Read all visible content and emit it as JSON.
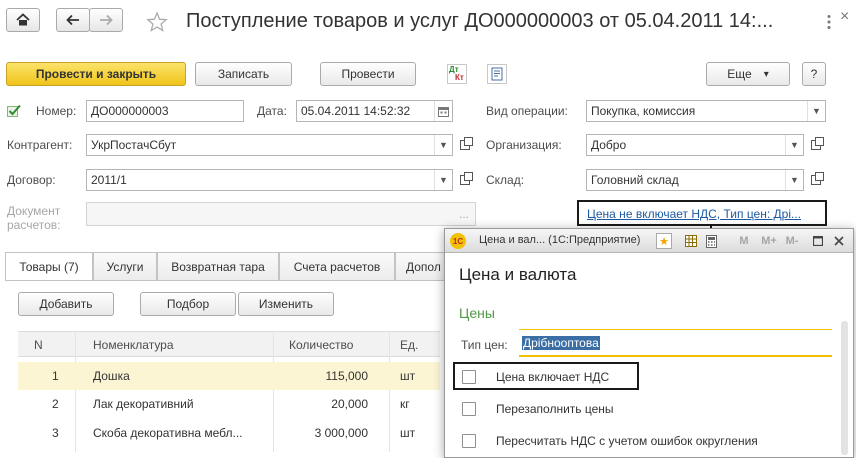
{
  "header": {
    "title": "Поступление товаров и услуг ДО000000003 от 05.04.2011 14:...",
    "more_icon": "more-vertical",
    "close_icon": "×"
  },
  "toolbar": {
    "post_close": "Провести и закрыть",
    "save": "Записать",
    "post": "Провести",
    "dt_kt_top": "Дт",
    "dt_kt_bottom": "Кт",
    "more": "Еще",
    "more_arrow": "▾",
    "help": "?"
  },
  "form": {
    "number_label": "Номер:",
    "number_value": "ДО000000003",
    "date_label": "Дата:",
    "date_value": "05.04.2011 14:52:32",
    "operation_label": "Вид операции:",
    "operation_value": "Покупка, комиссия",
    "counterparty_label": "Контрагент:",
    "counterparty_value": "УкрПостачСбут",
    "organization_label": "Организация:",
    "organization_value": "Добро",
    "contract_label": "Договор:",
    "contract_value": "2011/1",
    "warehouse_label": "Склад:",
    "warehouse_value": "Головний склад",
    "settlement_doc_label_1": "Документ",
    "settlement_doc_label_2": "расчетов:",
    "ellipsis": "...",
    "price_link": "Цена не включает НДС, Тип цен: Дрі..."
  },
  "tabs": [
    {
      "label": "Товары (7)"
    },
    {
      "label": "Услуги"
    },
    {
      "label": "Возвратная тара"
    },
    {
      "label": "Счета расчетов"
    },
    {
      "label": "Допол"
    }
  ],
  "table_toolbar": {
    "add": "Добавить",
    "select": "Подбор",
    "edit": "Изменить"
  },
  "table": {
    "columns": [
      "N",
      "Номенклатура",
      "Количество",
      "Ед."
    ],
    "rows": [
      {
        "n": "1",
        "name": "Дошка",
        "qty": "115,000",
        "unit": "шт"
      },
      {
        "n": "2",
        "name": "Лак декоративний",
        "qty": "20,000",
        "unit": "кг"
      },
      {
        "n": "3",
        "name": "Скоба декоративна мебл...",
        "qty": "3 000,000",
        "unit": "шт"
      }
    ]
  },
  "modal": {
    "window_title": "Цена и вал... (1С:Предприятие)",
    "logo_text": "1С",
    "m_label": "M",
    "m_plus_label": "M+",
    "m_minus_label": "M-",
    "heading": "Цена и валюта",
    "section": "Цены",
    "price_type_label": "Тип цен:",
    "price_type_value": "Дрібнооптова",
    "cb_includes_vat": "Цена включает НДС",
    "cb_refill_prices": "Перезаполнить цены",
    "cb_recalc_vat": "Пересчитать НДС с учетом ошибок округления"
  },
  "colors": {
    "primary_button": "#f0c419",
    "link": "#1d5aa3",
    "selected_row": "#fbf5d3",
    "focus_underline": "#f2c200"
  }
}
